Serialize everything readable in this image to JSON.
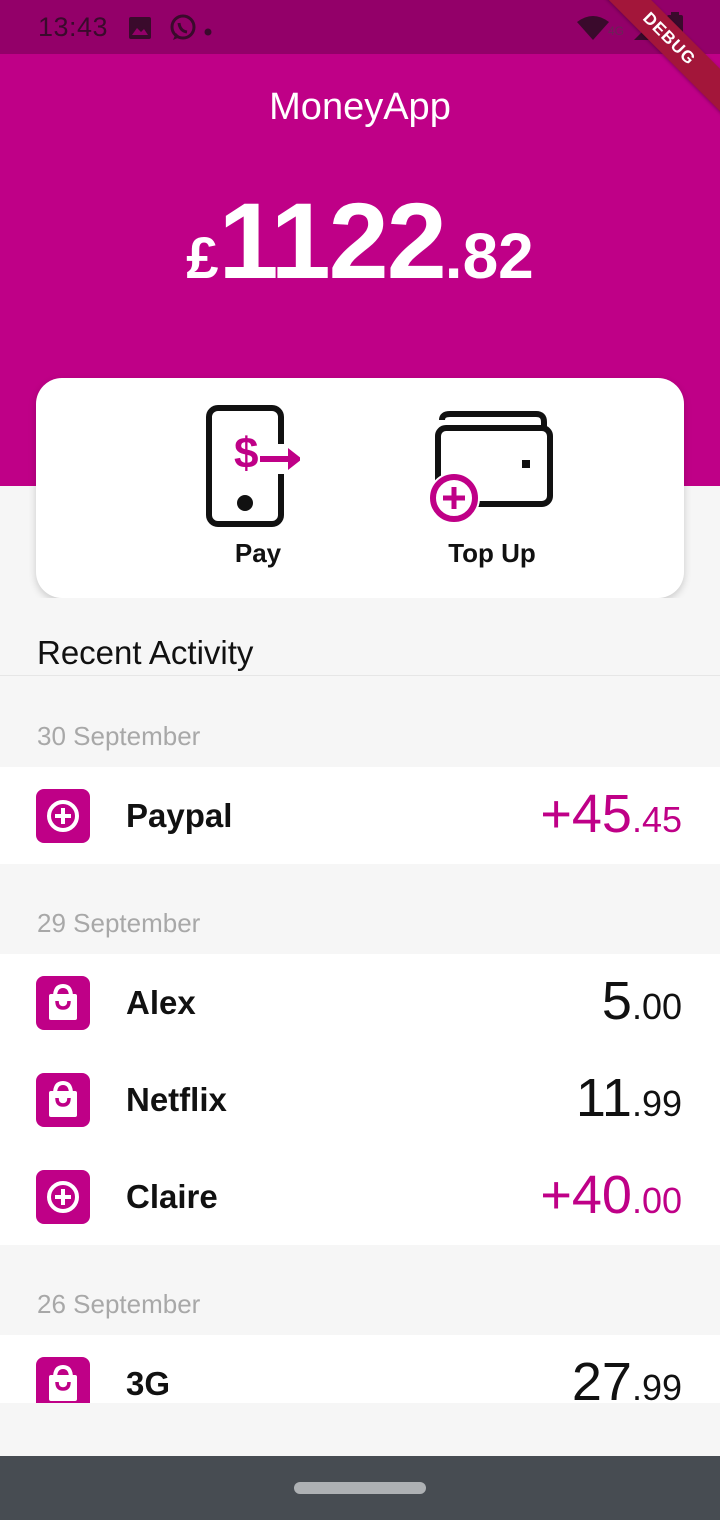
{
  "status_bar": {
    "time": "13:43",
    "icons": [
      "image-icon",
      "whatsapp-icon",
      "dot-icon",
      "wifi-icon",
      "signal-icon",
      "battery-icon"
    ],
    "network": "4G"
  },
  "debug_banner": "DEBUG",
  "app": {
    "title": "MoneyApp"
  },
  "balance": {
    "currency": "£",
    "whole": "1122",
    "fraction": ".82"
  },
  "actions": [
    {
      "label": "Pay",
      "icon": "phone-pay-icon"
    },
    {
      "label": "Top Up",
      "icon": "wallet-add-icon"
    }
  ],
  "recent_activity": {
    "title": "Recent Activity",
    "groups": [
      {
        "date": "30 September",
        "items": [
          {
            "name": "Paypal",
            "icon": "plus-icon",
            "whole": "+45",
            "fraction": ".45",
            "credit": true
          }
        ]
      },
      {
        "date": "29 September",
        "items": [
          {
            "name": "Alex",
            "icon": "shopping-bag-icon",
            "whole": "5",
            "fraction": ".00",
            "credit": false
          },
          {
            "name": "Netflix",
            "icon": "shopping-bag-icon",
            "whole": "11",
            "fraction": ".99",
            "credit": false
          },
          {
            "name": "Claire",
            "icon": "plus-icon",
            "whole": "+40",
            "fraction": ".00",
            "credit": true
          }
        ]
      },
      {
        "date": "26 September",
        "items": [
          {
            "name": "3G",
            "icon": "shopping-bag-icon",
            "whole": "27",
            "fraction": ".99",
            "credit": false
          }
        ]
      }
    ]
  },
  "colors": {
    "brand": "#bf0087",
    "status_bar": "#930069",
    "background": "#f6f6f6",
    "credit_amount": "#bf0087",
    "debit_amount": "#111111",
    "date_label": "#a8a8a8",
    "nav_bar": "#474c52"
  }
}
